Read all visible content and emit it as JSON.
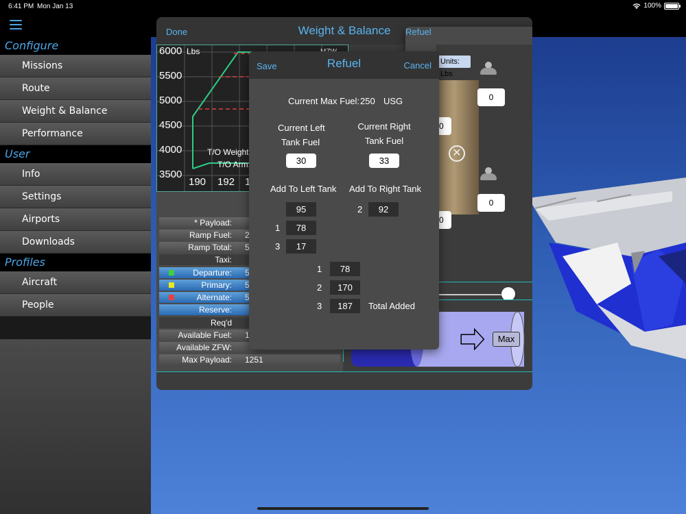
{
  "status": {
    "time": "6:41 PM",
    "date": "Mon Jan 13",
    "battery": "100%"
  },
  "sidebar": {
    "sections": [
      {
        "title": "Configure",
        "items": [
          "Missions",
          "Route",
          "Weight & Balance",
          "Performance"
        ]
      },
      {
        "title": "User",
        "items": [
          "Info",
          "Settings",
          "Airports",
          "Downloads"
        ]
      },
      {
        "title": "Profiles",
        "items": [
          "Aircraft",
          "People"
        ]
      }
    ]
  },
  "wb": {
    "done_label": "Done",
    "title": "Weight & Balance",
    "refuel_label": "Refuel",
    "units_label": "Units: Lbs",
    "max_label": "Max",
    "chart": {
      "y_ticks": [
        "6000",
        "5500",
        "5000",
        "4500",
        "4000",
        "3500"
      ],
      "y_unit": "Lbs",
      "x_ticks": [
        "190",
        "192",
        "1"
      ],
      "mz_label": "MZW",
      "to_weight": "T/O Weight:",
      "to_arm": "T/O Arm:"
    },
    "seats": {
      "top_right": "0",
      "mid_left": "0",
      "bottom_right": "0",
      "bottom_left": "0"
    },
    "rows": [
      {
        "label": "* Payload:",
        "value": "",
        "style": "gray"
      },
      {
        "label": "Ramp Fuel:",
        "value": "2",
        "style": "gray"
      },
      {
        "label": "Ramp Total:",
        "value": "5",
        "style": "gray"
      },
      {
        "label": "Taxi:",
        "value": "",
        "style": "dark"
      },
      {
        "label": "Departure:",
        "value": "5",
        "style": "blue",
        "color": "#3fd03f"
      },
      {
        "label": "Primary:",
        "value": "5",
        "style": "blue",
        "color": "#e8e820"
      },
      {
        "label": "Alternate:",
        "value": "5",
        "style": "blue",
        "color": "#e84040"
      },
      {
        "label": "Reserve:",
        "value": "",
        "style": "blue"
      },
      {
        "label": "Req'd",
        "value": "",
        "style": "dark"
      },
      {
        "label": "Available Fuel:",
        "value": "1",
        "style": "gray"
      },
      {
        "label": "Available ZFW:",
        "value": "",
        "style": "gray"
      },
      {
        "label": "Max Payload:",
        "value": "1251",
        "style": "gray"
      }
    ]
  },
  "refuel": {
    "save_label": "Save",
    "title": "Refuel",
    "cancel_label": "Cancel",
    "max_fuel_label": "Current Max Fuel:",
    "max_fuel_value": "250",
    "max_fuel_unit": "USG",
    "left_label_1": "Current Left",
    "left_label_2": "Tank Fuel",
    "right_label_1": "Current Right",
    "right_label_2": "Tank Fuel",
    "left_value": "30",
    "right_value": "33",
    "add_left_label": "Add To Left Tank",
    "add_right_label": "Add To Right Tank",
    "left_options": [
      {
        "num": "",
        "value": "95"
      },
      {
        "num": "1",
        "value": "78"
      },
      {
        "num": "3",
        "value": "17"
      }
    ],
    "right_options": [
      {
        "num": "2",
        "value": "92"
      }
    ],
    "totals": [
      {
        "num": "1",
        "value": "78"
      },
      {
        "num": "2",
        "value": "170"
      },
      {
        "num": "3",
        "value": "187"
      }
    ],
    "total_label": "Total Added"
  }
}
